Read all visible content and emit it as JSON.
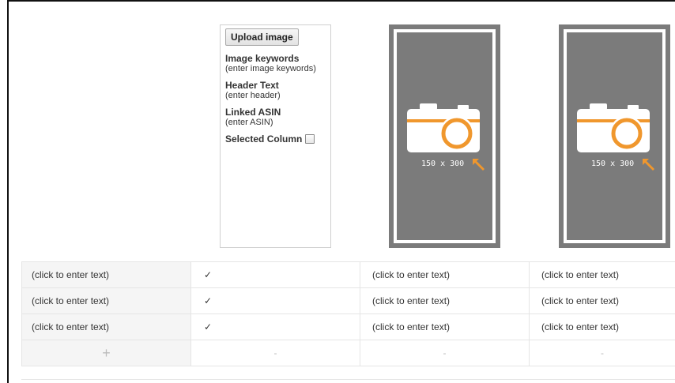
{
  "editor": {
    "upload_button": "Upload image",
    "keywords_title": "Image keywords",
    "keywords_hint": "(enter image keywords)",
    "header_title": "Header Text",
    "header_hint": "(enter header)",
    "asin_title": "Linked ASIN",
    "asin_hint": "(enter ASIN)",
    "selected_label": "Selected Column",
    "selected_checked": false
  },
  "placeholders": [
    {
      "size_label": "150 x 300",
      "icon": "camera-icon"
    },
    {
      "size_label": "150 x 300",
      "icon": "camera-icon"
    }
  ],
  "table": {
    "rows": [
      [
        "(click to enter text)",
        "✓",
        "(click to enter text)",
        "(click to enter text)"
      ],
      [
        "(click to enter text)",
        "✓",
        "(click to enter text)",
        "(click to enter text)"
      ],
      [
        "(click to enter text)",
        "✓",
        "(click to enter text)",
        "(click to enter text)"
      ]
    ],
    "controls": [
      "+",
      "-",
      "-",
      "-"
    ]
  },
  "colors": {
    "placeholder_bg": "#7b7b7b",
    "accent_orange": "#f0972d",
    "label_bg": "#f5f5f5"
  }
}
